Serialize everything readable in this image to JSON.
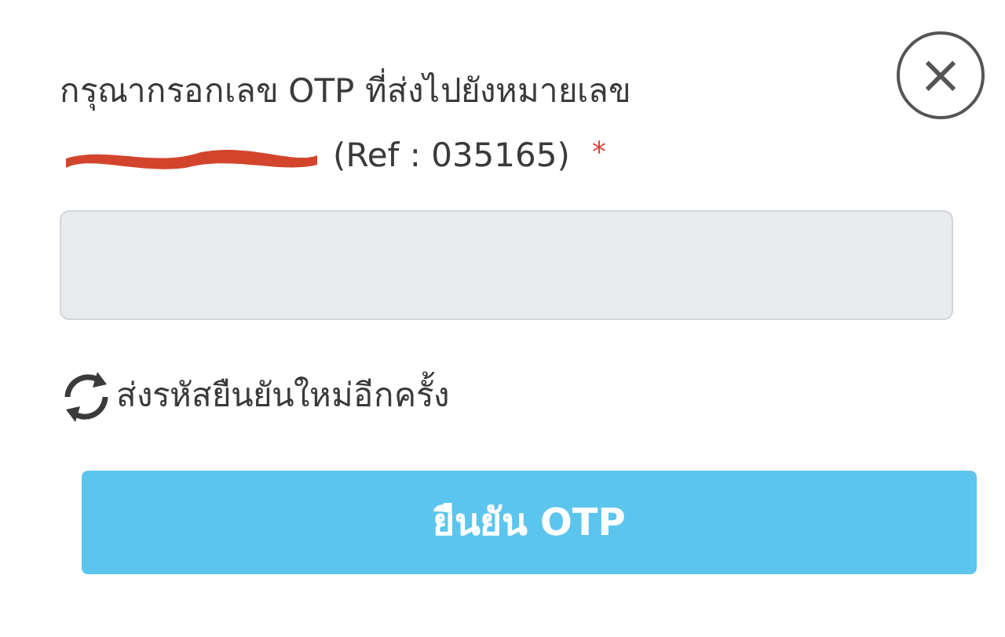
{
  "prompt": {
    "line_1": "กรุณากรอกเลข OTP ที่ส่งไปยังหมายเลข",
    "reference": "(Ref : 035165)",
    "required_mark": "*"
  },
  "close_button": {
    "label": "×"
  },
  "resend_link": {
    "label": "ส่งรหัสยืนยันใหม่อีกครั้ง"
  },
  "confirm_button": {
    "label": "ยืนยัน OTP"
  }
}
